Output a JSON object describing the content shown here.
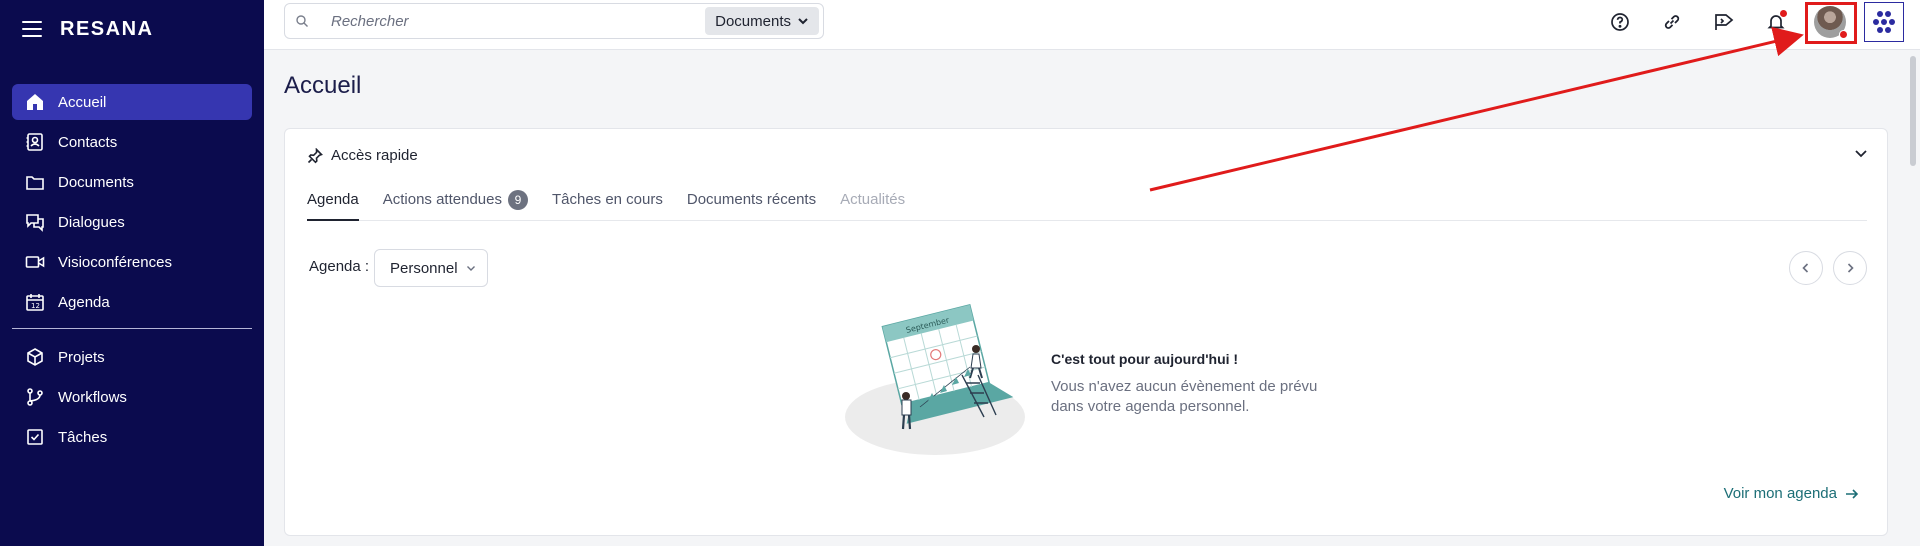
{
  "app": {
    "brand": "RESANA"
  },
  "sidebar": {
    "items": [
      {
        "label": "Accueil",
        "icon": "home-icon"
      },
      {
        "label": "Contacts",
        "icon": "contact-card-icon"
      },
      {
        "label": "Documents",
        "icon": "folder-icon"
      },
      {
        "label": "Dialogues",
        "icon": "chat-icon"
      },
      {
        "label": "Visioconférences",
        "icon": "video-icon"
      },
      {
        "label": "Agenda",
        "icon": "calendar-icon"
      }
    ],
    "items2": [
      {
        "label": "Projets",
        "icon": "cube-icon"
      },
      {
        "label": "Workflows",
        "icon": "workflow-icon"
      },
      {
        "label": "Tâches",
        "icon": "checkbox-icon"
      }
    ]
  },
  "search": {
    "placeholder": "Rechercher",
    "scope": "Documents"
  },
  "page": {
    "title": "Accueil"
  },
  "quick_access": {
    "title": "Accès rapide",
    "tabs": [
      {
        "label": "Agenda"
      },
      {
        "label": "Actions attendues",
        "badge": "9"
      },
      {
        "label": "Tâches en cours"
      },
      {
        "label": "Documents récents"
      },
      {
        "label": "Actualités"
      }
    ],
    "agenda_label": "Agenda :",
    "agenda_select": "Personnel",
    "empty_title": "C'est tout pour aujourd'hui !",
    "empty_text": "Vous n'avez aucun évènement de prévu dans votre agenda personnel.",
    "link": "Voir mon agenda",
    "calendar_month": "September"
  },
  "colors": {
    "sidebar_bg": "#0b0b4e",
    "sidebar_active": "#3636b0",
    "accent_link": "#1c6e76",
    "notification": "#e01b1b",
    "annotation": "#e01b1b"
  }
}
